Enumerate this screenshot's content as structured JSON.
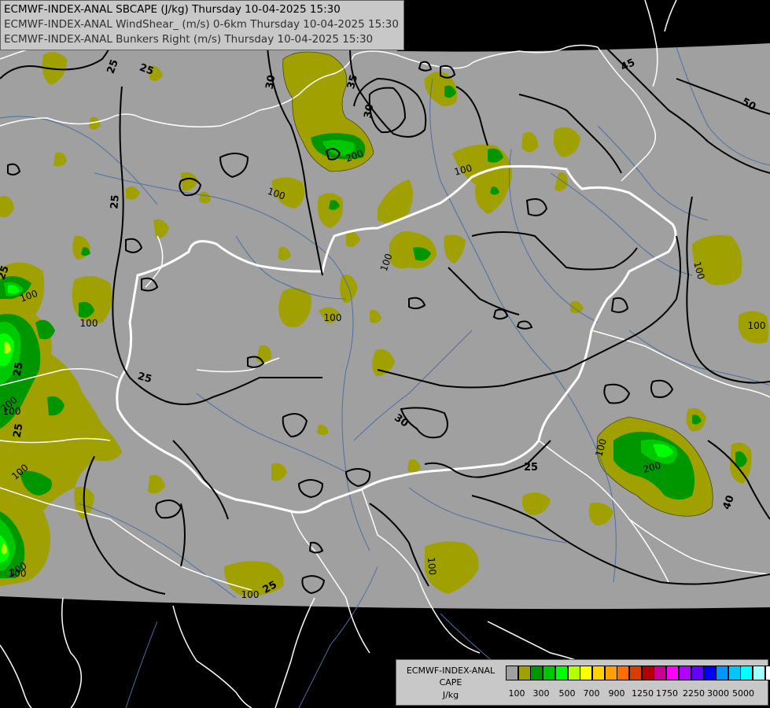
{
  "titles": [
    "ECMWF-INDEX-ANAL SBCAPE (J/kg) Thursday 10-04-2025 15:30",
    "ECMWF-INDEX-ANAL WindShear_ (m/s) 0-6km Thursday 10-04-2025 15:30",
    "ECMWF-INDEX-ANAL Bunkers Right (m/s) Thursday 10-04-2025 15:30"
  ],
  "legend": {
    "line1": "ECMWF-INDEX-ANAL",
    "line2": "CAPE",
    "line3": "J/kg",
    "colors": [
      "#a0a0a0",
      "#a0a000",
      "#009600",
      "#00c800",
      "#00ff00",
      "#b4ff00",
      "#ffff00",
      "#ffd200",
      "#ffa000",
      "#ff6e00",
      "#dc3c00",
      "#b40000",
      "#c80096",
      "#ff00ff",
      "#b400ff",
      "#6400ff",
      "#0000ff",
      "#0096ff",
      "#00c8ff",
      "#00ffff",
      "#a0ffff",
      "#ffffff"
    ],
    "ticks": [
      "100",
      "300",
      "500",
      "700",
      "900",
      "1250",
      "1750",
      "2250",
      "3000",
      "5000"
    ]
  },
  "contour_labels": {
    "shear": [
      "25",
      "25",
      "30",
      "35",
      "30",
      "45",
      "50",
      "40",
      "25",
      "30",
      "25",
      "25",
      "25",
      "25",
      "25",
      "25"
    ],
    "cape": [
      "100",
      "100",
      "200",
      "100",
      "100",
      "100",
      "100",
      "100",
      "100",
      "100",
      "200",
      "100",
      "100",
      "100",
      "200",
      "200",
      "100",
      "100"
    ]
  },
  "colors": {
    "outside_domain": "#000000",
    "domain_background": "#a0a0a0",
    "cape_100": "#a0a000",
    "cape_300": "#009600",
    "cape_500": "#00c800",
    "cape_700": "#00ff00",
    "cape_900": "#b4ff00",
    "border": "#ffffff",
    "river": "#4a6fa5",
    "contour": "#000000"
  }
}
